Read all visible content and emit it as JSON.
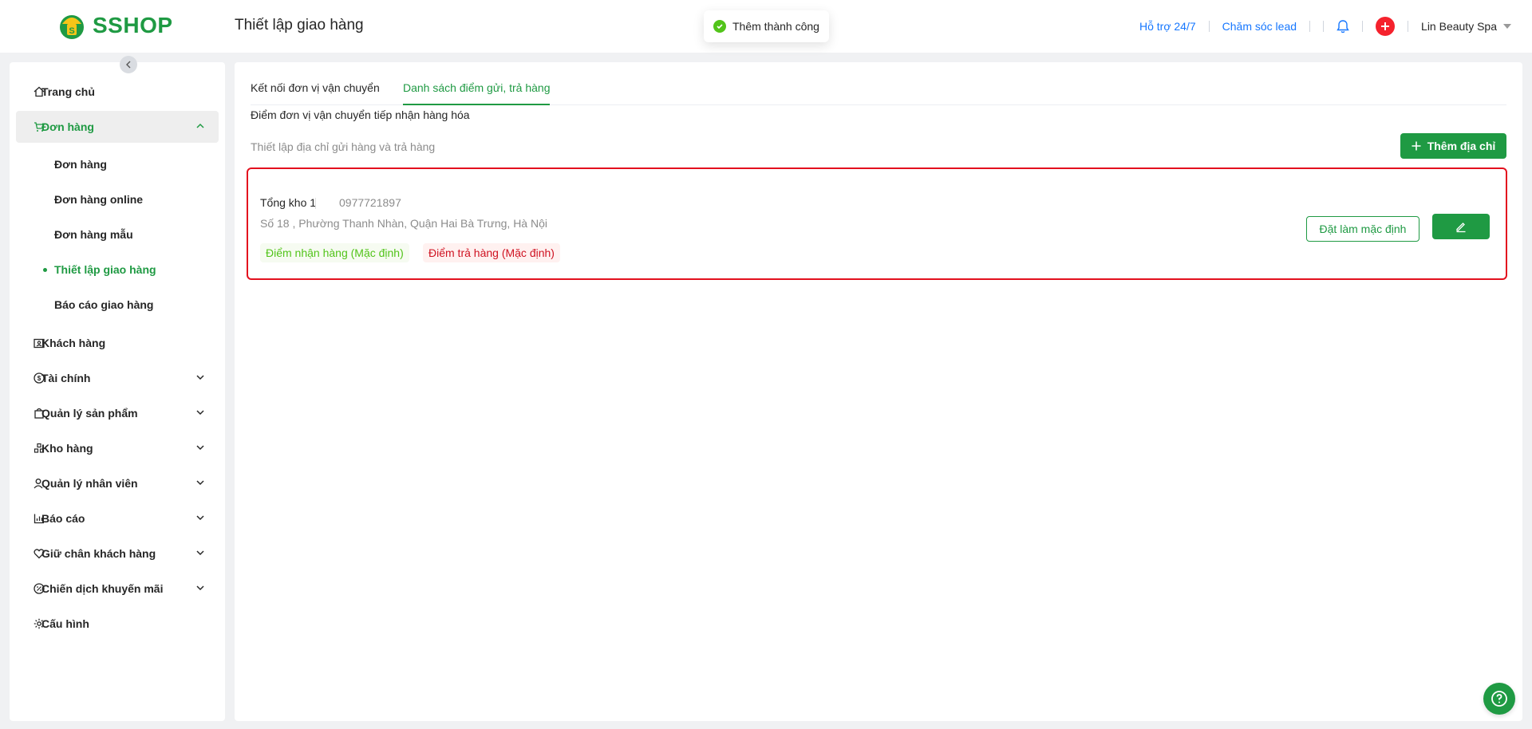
{
  "header": {
    "logo_text": "SSHOP",
    "page_title": "Thiết lập giao hàng",
    "toast": "Thêm thành công",
    "support_link": "Hỗ trợ 24/7",
    "lead_link": "Chăm sóc lead",
    "user_name": "Lin Beauty Spa"
  },
  "sidebar": {
    "items": {
      "home": "Trang chủ",
      "orders": "Đơn hàng",
      "customers": "Khách hàng",
      "finance": "Tài chính",
      "products": "Quản lý sản phẩm",
      "warehouse": "Kho hàng",
      "staff": "Quản lý nhân viên",
      "reports": "Báo cáo",
      "retention": "Giữ chân khách hàng",
      "promotions": "Chiến dịch khuyến mãi",
      "config": "Cấu hình"
    },
    "order_subitems": {
      "orders": "Đơn hàng",
      "online": "Đơn hàng online",
      "template": "Đơn hàng mẫu",
      "shipping_setup": "Thiết lập giao hàng",
      "shipping_report": "Báo cáo giao hàng"
    }
  },
  "main": {
    "tabs": {
      "connect": "Kết nối đơn vị vận chuyển",
      "pickup_list": "Danh sách điểm gửi, trả hàng"
    },
    "section_title": "Điểm đơn vị vận chuyển tiếp nhận hàng hóa",
    "section_subtitle": "Thiết lập địa chỉ gửi hàng và trả hàng",
    "add_button": "Thêm địa chỉ",
    "address_card": {
      "name": "Tổng kho 1",
      "phone": "0977721897",
      "address": "Số 18 , Phường Thanh Nhàn, Quận Hai Bà Trưng, Hà Nội",
      "tag_pickup": "Điểm nhận hàng (Mặc định)",
      "tag_return": "Điểm trả hàng (Mặc định)",
      "set_default_button": "Đặt làm mặc định"
    }
  },
  "colors": {
    "brand_green": "#1f9a43",
    "danger_red": "#e3101e",
    "link_blue": "#1677ff"
  }
}
